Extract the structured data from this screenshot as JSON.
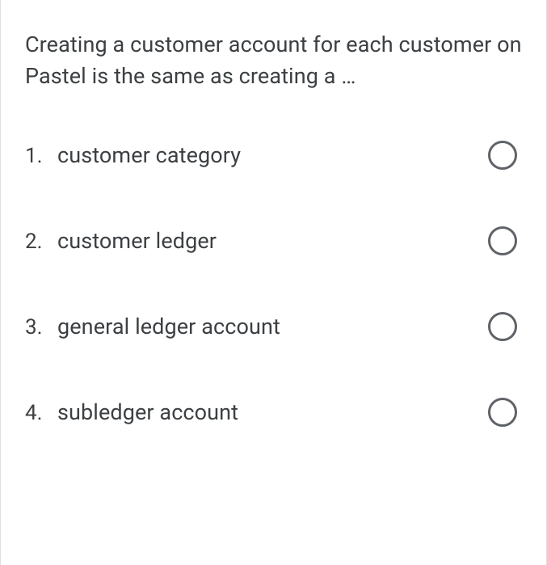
{
  "question": "Creating a customer account for each customer on Pastel is the same as creating a …",
  "options": [
    {
      "number": "1.",
      "text": "customer category"
    },
    {
      "number": "2.",
      "text": "customer ledger"
    },
    {
      "number": "3.",
      "text": "general ledger account"
    },
    {
      "number": "4.",
      "text": "subledger account"
    }
  ]
}
